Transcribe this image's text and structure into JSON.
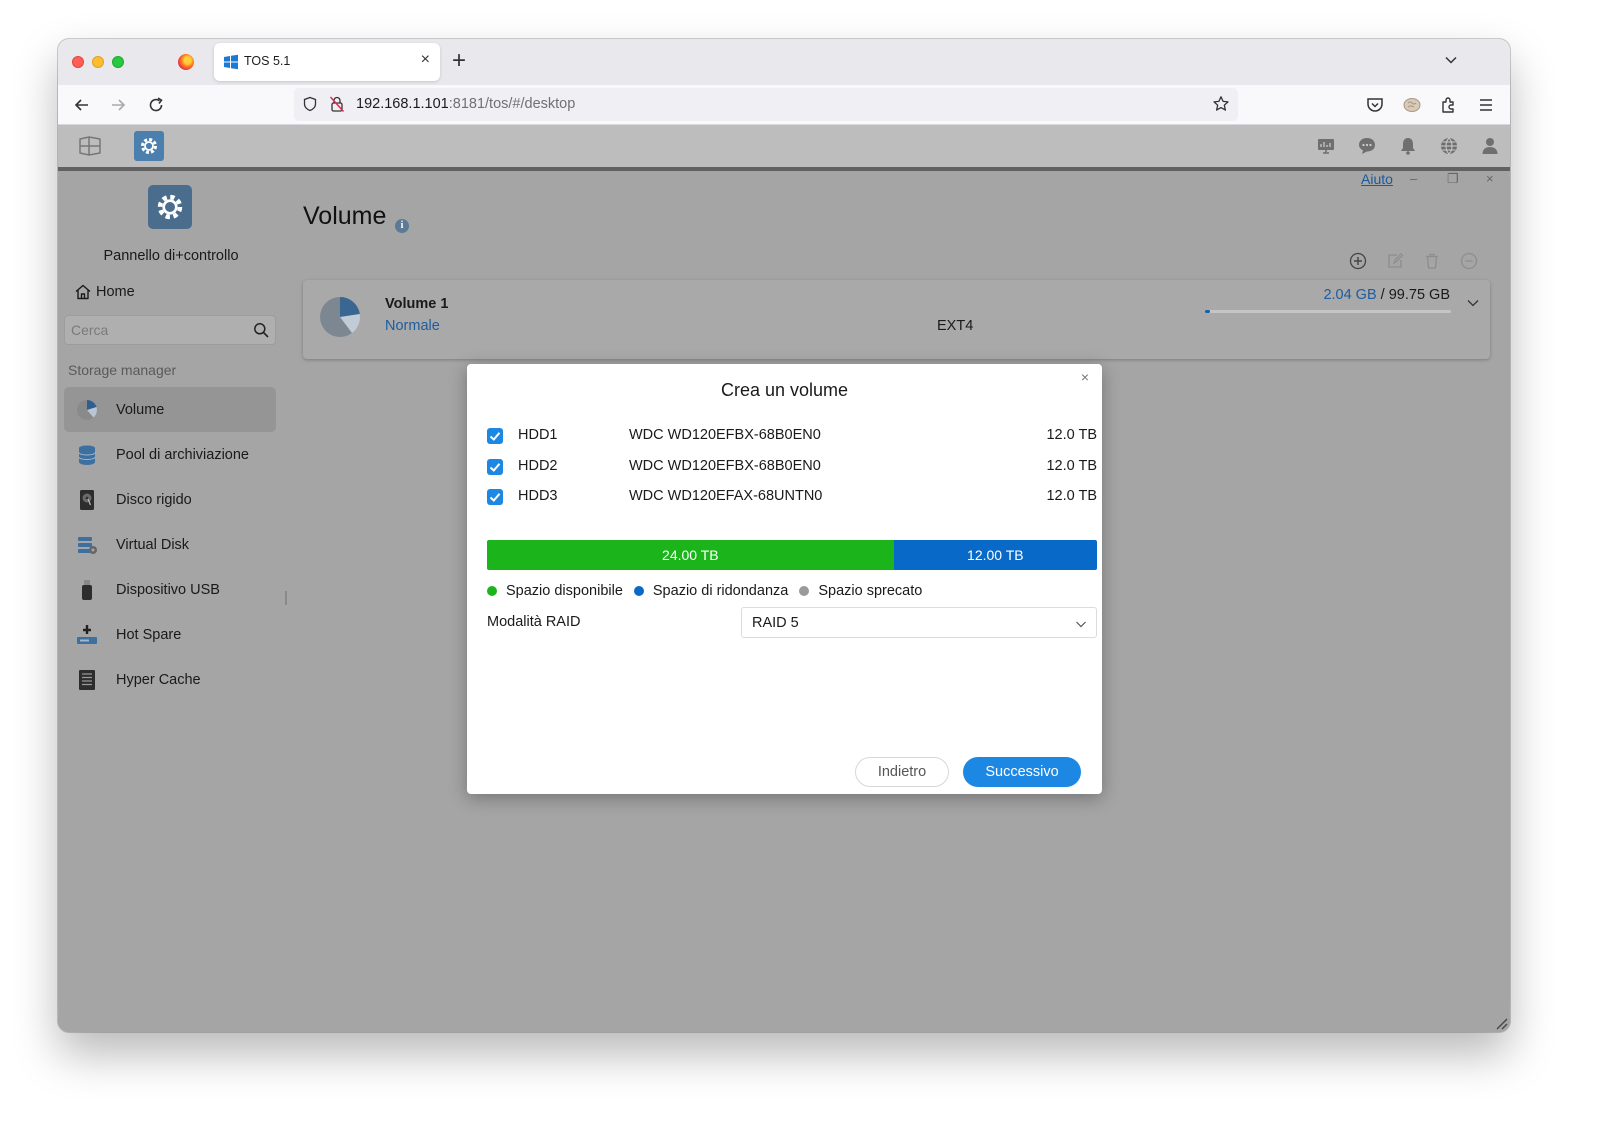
{
  "browser": {
    "tab_title": "TOS 5.1",
    "url_host": "192.168.1.101",
    "url_rest": ":8181/tos/#/desktop",
    "new_tab_label": "+",
    "tab_close_label": "×"
  },
  "app": {
    "help_label": "Aiuto",
    "minimize_label": "–",
    "restore_label": "❐",
    "close_label": "×"
  },
  "sidebar": {
    "title": "Pannello di+controllo",
    "home_label": "Home",
    "search_placeholder": "Cerca",
    "section_label": "Storage manager",
    "items": [
      {
        "label": "Volume",
        "icon": "pie-icon",
        "active": true
      },
      {
        "label": "Pool di archiviazione",
        "icon": "storage-pool-icon"
      },
      {
        "label": "Disco rigido",
        "icon": "hard-disk-icon"
      },
      {
        "label": "Virtual Disk",
        "icon": "virtual-disk-icon"
      },
      {
        "label": "Dispositivo USB",
        "icon": "usb-icon"
      },
      {
        "label": "Hot Spare",
        "icon": "hot-spare-icon"
      },
      {
        "label": "Hyper Cache",
        "icon": "hyper-cache-icon"
      }
    ]
  },
  "main": {
    "title": "Volume",
    "info_badge": "i",
    "volume": {
      "name": "Volume 1",
      "status": "Normale",
      "filesystem": "EXT4",
      "used": "2.04 GB",
      "separator": " / ",
      "total": "99.75 GB",
      "usage_fraction": 0.02
    }
  },
  "dialog": {
    "title": "Crea un volume",
    "close_label": "×",
    "disks": [
      {
        "id": "HDD1",
        "model": "WDC WD120EFBX-68B0EN0",
        "size": "12.0 TB",
        "checked": true
      },
      {
        "id": "HDD2",
        "model": "WDC WD120EFBX-68B0EN0",
        "size": "12.0 TB",
        "checked": true
      },
      {
        "id": "HDD3",
        "model": "WDC WD120EFAX-68UNTN0",
        "size": "12.0 TB",
        "checked": true
      }
    ],
    "capacity": {
      "available_label": "24.00 TB",
      "redundancy_label": "12.00 TB",
      "available_tb": 24,
      "redundancy_tb": 12
    },
    "legend": [
      {
        "label": "Spazio disponibile",
        "color": "#1bb51b"
      },
      {
        "label": "Spazio di ridondanza",
        "color": "#0969c8"
      },
      {
        "label": "Spazio sprecato",
        "color": "#9a9a9a"
      }
    ],
    "raid_label": "Modalità RAID",
    "raid_value": "RAID 5",
    "back_label": "Indietro",
    "next_label": "Successivo"
  },
  "colors": {
    "accent": "#1c88e3",
    "link": "#1d5da0",
    "available": "#1bb51b",
    "redundancy": "#0969c8"
  }
}
